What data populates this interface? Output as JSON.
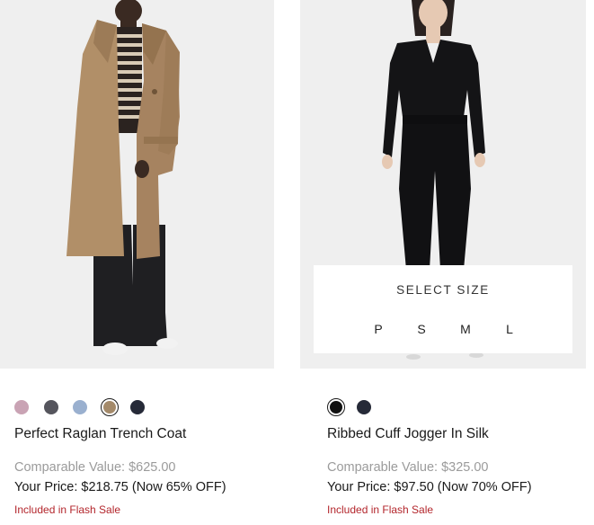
{
  "products": [
    {
      "name": "Perfect Raglan Trench Coat",
      "comparable_value": "Comparable Value: $625.00",
      "your_price": "Your Price: $218.75 (Now 65% OFF)",
      "flash_sale": "Included in Flash Sale",
      "swatches": [
        {
          "name": "mauve",
          "color": "#c9a3b4",
          "selected": false
        },
        {
          "name": "charcoal",
          "color": "#55555d",
          "selected": false
        },
        {
          "name": "light-blue",
          "color": "#9ab0cf",
          "selected": false
        },
        {
          "name": "camel",
          "color": "#a48a6a",
          "selected": true
        },
        {
          "name": "navy",
          "color": "#262a38",
          "selected": false
        }
      ]
    },
    {
      "name": "Ribbed Cuff Jogger In Silk",
      "comparable_value": "Comparable Value: $325.00",
      "your_price": "Your Price: $97.50 (Now 70% OFF)",
      "flash_sale": "Included in Flash Sale",
      "swatches": [
        {
          "name": "black",
          "color": "#111111",
          "selected": true
        },
        {
          "name": "navy",
          "color": "#262a38",
          "selected": false
        }
      ],
      "size_selector": {
        "title": "SELECT SIZE",
        "options": [
          "P",
          "S",
          "M",
          "L"
        ]
      }
    }
  ]
}
